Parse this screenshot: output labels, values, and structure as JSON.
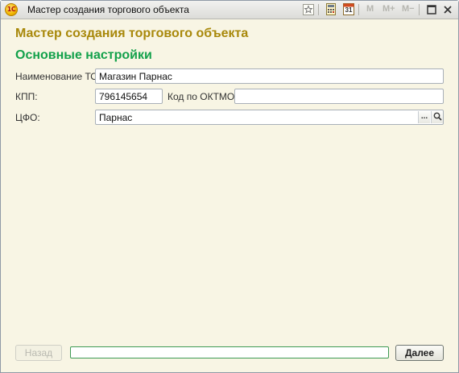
{
  "window": {
    "title": "Мастер создания торгового объекта",
    "app_icon_text": "1С"
  },
  "titlebar": {
    "mem_labels": [
      "M",
      "M+",
      "M−"
    ],
    "calendar_day": "31"
  },
  "main": {
    "heading": "Мастер создания торгового объекта",
    "section_title": "Основные настройки"
  },
  "form": {
    "name_label": "Наименование ТО:",
    "name_value": "Магазин Парнас",
    "kpp_label": "КПП:",
    "kpp_value": "796145654",
    "oktmo_label": "Код по ОКТМО:",
    "oktmo_value": "",
    "cfo_label": "ЦФО:",
    "cfo_value": "Парнас",
    "cfo_select_glyph": "...",
    "cfo_search_glyph": "⚲"
  },
  "footer": {
    "back_label": "Назад",
    "next_label": "Далее",
    "progress": 0
  },
  "colors": {
    "heading": "#a8880a",
    "section_title": "#13a14b",
    "background": "#f8f5e4",
    "progress_border": "#3e9a55"
  },
  "icons": {
    "app": "1c-logo-icon",
    "favorite": "star-icon",
    "calculator": "calculator-icon",
    "calendar": "calendar-icon",
    "restore": "restore-window-icon",
    "close": "close-icon"
  }
}
